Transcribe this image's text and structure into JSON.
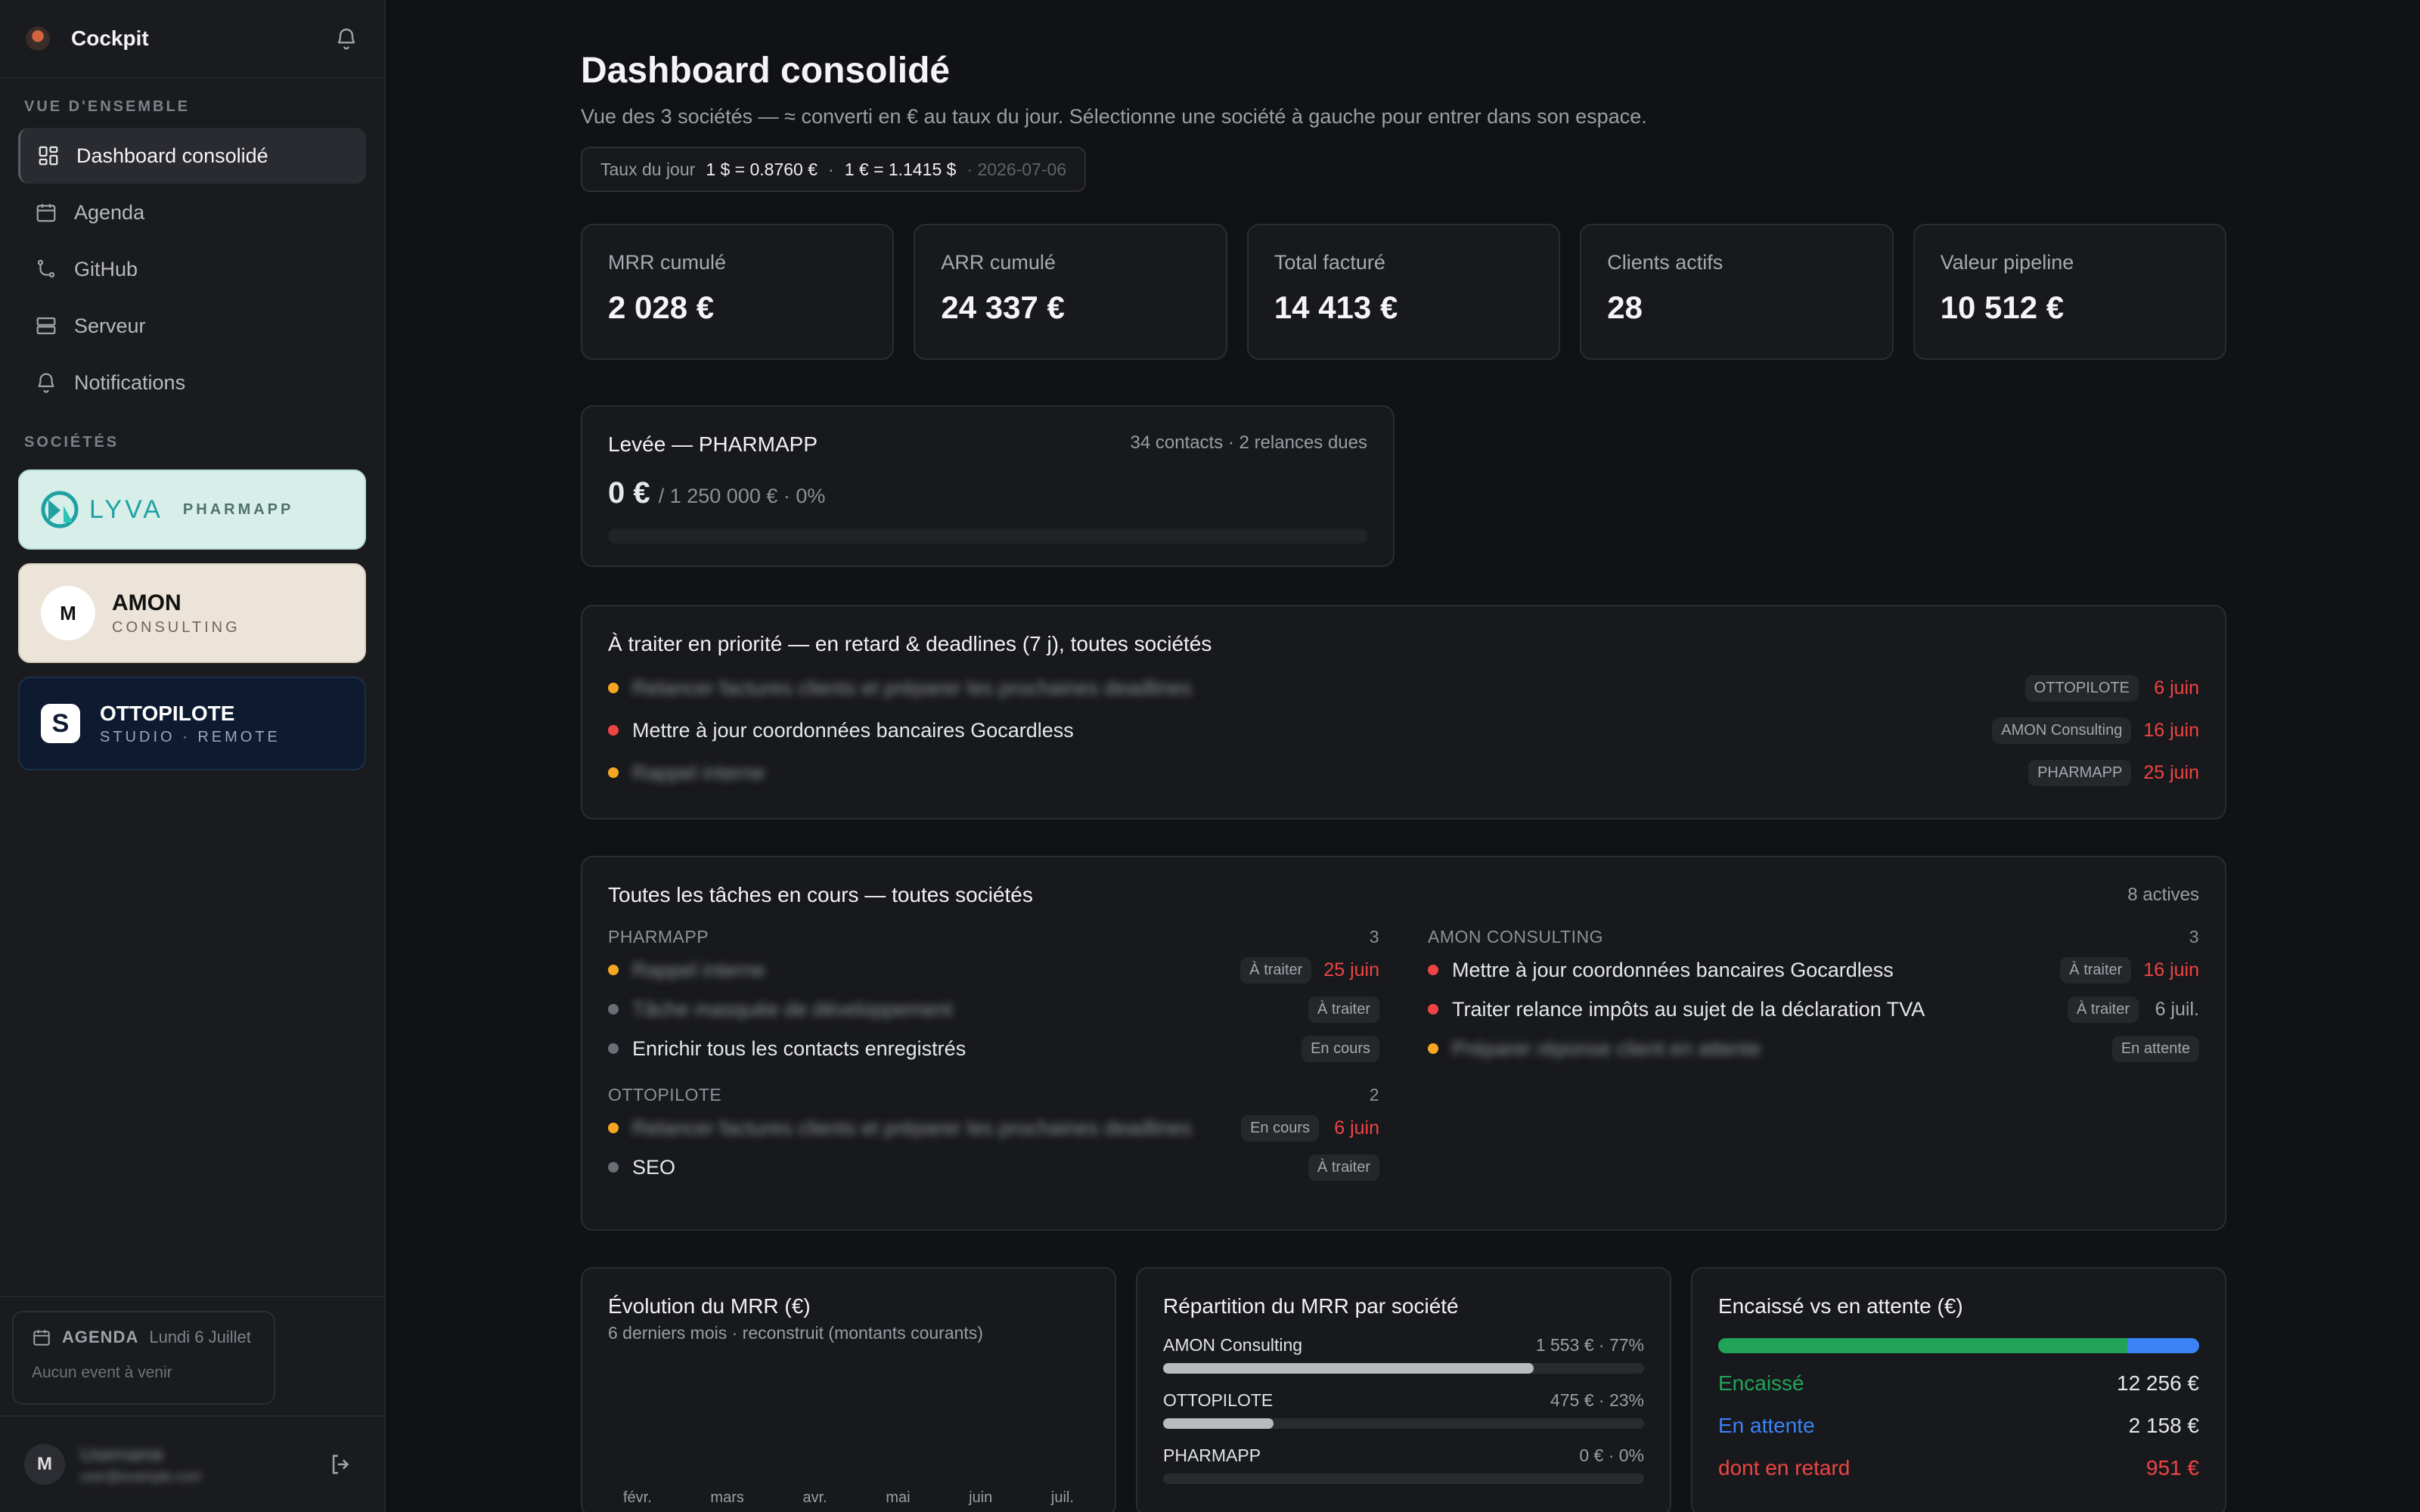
{
  "sidebar": {
    "brand": "Cockpit",
    "overview_label": "VUE D'ENSEMBLE",
    "nav": [
      {
        "label": "Dashboard consolidé",
        "icon": "grid-icon",
        "active": true
      },
      {
        "label": "Agenda",
        "icon": "calendar-icon"
      },
      {
        "label": "GitHub",
        "icon": "git-branch-icon"
      },
      {
        "label": "Serveur",
        "icon": "server-icon"
      },
      {
        "label": "Notifications",
        "icon": "bell-icon"
      }
    ],
    "companies_label": "SOCIÉTÉS",
    "companies": [
      {
        "name": "LYVA",
        "sub": "PHARMAPP",
        "bg": "#d7efe8"
      },
      {
        "name": "AMON",
        "sub": "CONSULTING",
        "bg": "#ece4d8"
      },
      {
        "name": "OTTOPILOTE",
        "sub": "STUDIO · REMOTE",
        "bg": "#0d1a30"
      }
    ],
    "agenda": {
      "label": "AGENDA",
      "date": "Lundi 6 Juillet",
      "empty": "Aucun event à venir"
    },
    "user": {
      "initial": "M",
      "name": "Username",
      "email": "user@example.com"
    }
  },
  "header": {
    "title": "Dashboard consolidé",
    "subtitle": "Vue des 3 sociétés — ≈ converti en € au taux du jour. Sélectionne une société à gauche pour entrer dans son espace.",
    "rate": {
      "label": "Taux du jour",
      "usd_eur": "1 $ = 0.8760 €",
      "sep": "·",
      "eur_usd": "1 € = 1.1415 $",
      "date": "· 2026-07-06"
    }
  },
  "kpis": [
    {
      "label": "MRR cumulé",
      "value": "2 028 €"
    },
    {
      "label": "ARR cumulé",
      "value": "24 337 €"
    },
    {
      "label": "Total facturé",
      "value": "14 413 €"
    },
    {
      "label": "Clients actifs",
      "value": "28"
    },
    {
      "label": "Valeur pipeline",
      "value": "10 512 €"
    }
  ],
  "levee": {
    "title": "Levée — PHARMAPP",
    "meta": "34 contacts · 2 relances dues",
    "amount": "0 €",
    "target": "/ 1 250 000 € · 0%",
    "progress": 0
  },
  "priority": {
    "title": "À traiter en priorité — en retard & deadlines (7 j), toutes sociétés",
    "items": [
      {
        "text": "Relancer factures clients et préparer les prochaines deadlines",
        "blurred": true,
        "company": "OTTOPILOTE",
        "due": "6 juin",
        "dot": "orange"
      },
      {
        "text": "Mettre à jour coordonnées bancaires Gocardless",
        "blurred": false,
        "company": "AMON Consulting",
        "due": "16 juin",
        "dot": "red"
      },
      {
        "text": "Rappel interne",
        "blurred": true,
        "company": "PHARMAPP",
        "due": "25 juin",
        "dot": "orange"
      }
    ]
  },
  "tasks": {
    "title": "Toutes les tâches en cours — toutes sociétés",
    "count": "8 actives",
    "groups": [
      {
        "name": "PHARMAPP",
        "count": "3",
        "items": [
          {
            "text": "Rappel interne",
            "blurred": true,
            "status": "À traiter",
            "due": "25 juin",
            "dot": "orange"
          },
          {
            "text": "Tâche masquée de développement",
            "blurred": true,
            "status": "À traiter",
            "due": "",
            "dot": "gray"
          },
          {
            "text": "Enrichir tous les contacts enregistrés",
            "blurred": false,
            "status": "En cours",
            "due": "",
            "dot": "gray"
          }
        ]
      },
      {
        "name": "OTTOPILOTE",
        "count": "2",
        "items": [
          {
            "text": "Relancer factures clients et préparer les prochaines deadlines",
            "blurred": true,
            "status": "En cours",
            "due": "6 juin",
            "dot": "orange"
          },
          {
            "text": "SEO",
            "blurred": false,
            "status": "À traiter",
            "due": "",
            "dot": "gray"
          }
        ]
      },
      {
        "name": "AMON CONSULTING",
        "count": "3",
        "items": [
          {
            "text": "Mettre à jour coordonnées bancaires Gocardless",
            "blurred": false,
            "status": "À traiter",
            "due": "16 juin",
            "dot": "red"
          },
          {
            "text": "Traiter relance impôts au sujet de la déclaration TVA",
            "blurred": false,
            "status": "À traiter",
            "due": "6 juil.",
            "dot": "red",
            "due_neutral": true
          },
          {
            "text": "Préparer réponse client en attente",
            "blurred": true,
            "status": "En attente",
            "due": "",
            "dot": "orange"
          }
        ]
      }
    ]
  },
  "mrr": {
    "title": "Évolution du MRR (€)",
    "subtitle": "6 derniers mois · reconstruit (montants courants)",
    "months": [
      "févr.",
      "mars",
      "avr.",
      "mai",
      "juin",
      "juil."
    ]
  },
  "repartition": {
    "title": "Répartition du MRR par société",
    "rows": [
      {
        "name": "AMON Consulting",
        "value": "1 553 € · 77%",
        "pct": 77
      },
      {
        "name": "OTTOPILOTE",
        "value": "475 € · 23%",
        "pct": 23
      },
      {
        "name": "PHARMAPP",
        "value": "0 € · 0%",
        "pct": 0
      }
    ]
  },
  "encaisse": {
    "title": "Encaissé vs en attente (€)",
    "rows": [
      {
        "label": "Encaissé",
        "value": "12 256 €",
        "color": "#22a35a"
      },
      {
        "label": "En attente",
        "value": "2 158 €",
        "color": "#3b82f6"
      },
      {
        "label": "dont en retard",
        "value": "951 €",
        "color": "#ef4444"
      }
    ],
    "paid_share": 0.85
  }
}
